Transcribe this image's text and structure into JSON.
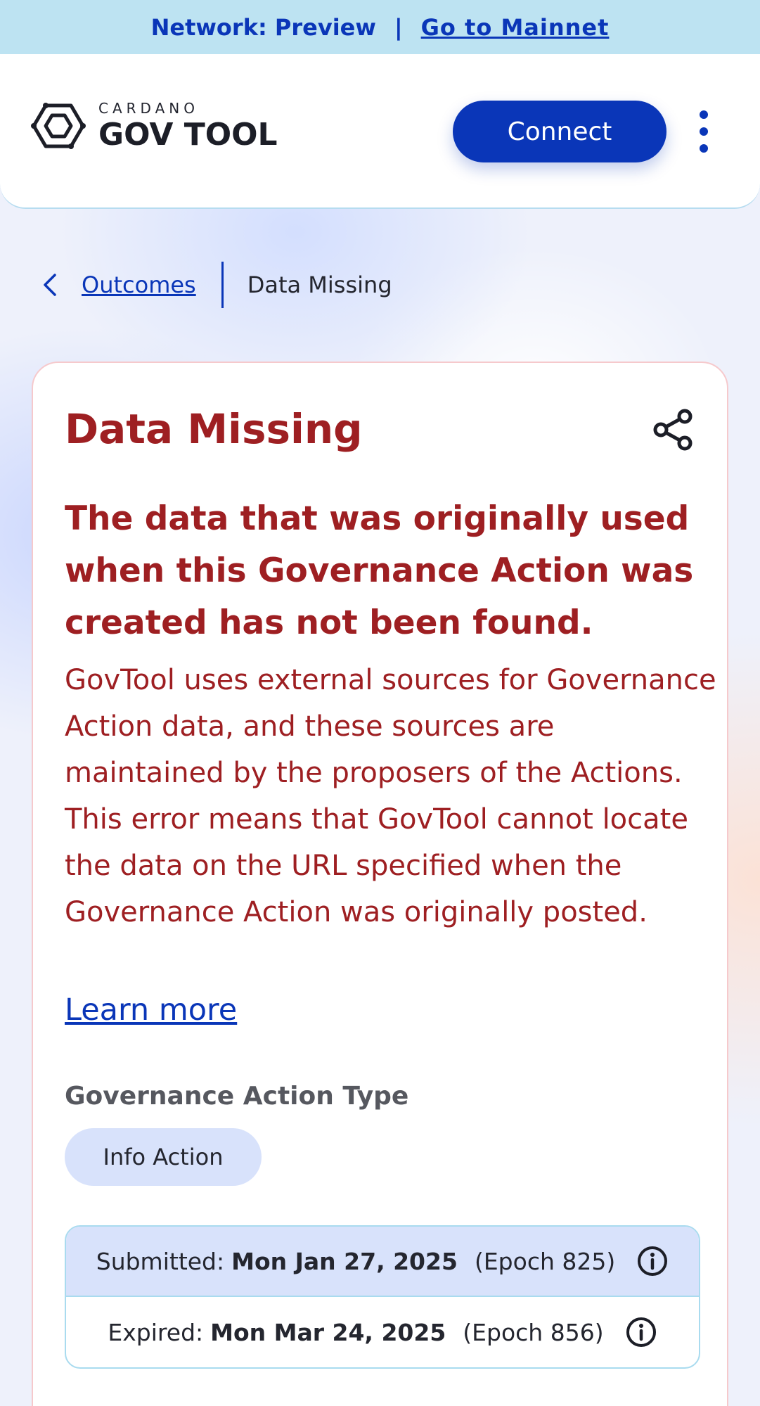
{
  "network_bar": {
    "network_label": "Network: Preview",
    "separator": "|",
    "mainnet_link": "Go to Mainnet"
  },
  "header": {
    "logo_small": "CARDANO",
    "logo_big": "GOV TOOL",
    "connect_label": "Connect",
    "menu_icon": "kebab-menu-icon"
  },
  "breadcrumb": {
    "back_icon": "chevron-left-icon",
    "parent_label": "Outcomes",
    "current_label": "Data Missing"
  },
  "card": {
    "title": "Data Missing",
    "share_icon": "share-icon",
    "error_heading": "The data that was originally used when this Governance Action was created has not been found.",
    "error_body": "GovTool uses external sources for Governance Action data, and these sources are maintained by the proposers of the Actions. This error means that GovTool cannot locate the data on the URL specified when the Governance Action was originally posted.",
    "learn_more_label": "Learn more",
    "governance_action_type_label": "Governance Action Type",
    "governance_action_type_value": "Info Action",
    "submitted": {
      "label": "Submitted:",
      "date": "Mon Jan 27, 2025",
      "epoch": "(Epoch 825)"
    },
    "expired": {
      "label": "Expired:",
      "date": "Mon Mar 24, 2025",
      "epoch": "(Epoch 856)"
    }
  },
  "colors": {
    "brand_blue": "#0a36b8",
    "error_red": "#9e1f22",
    "network_bar_bg": "#bde3f2",
    "chip_bg": "#d8e2fb"
  }
}
